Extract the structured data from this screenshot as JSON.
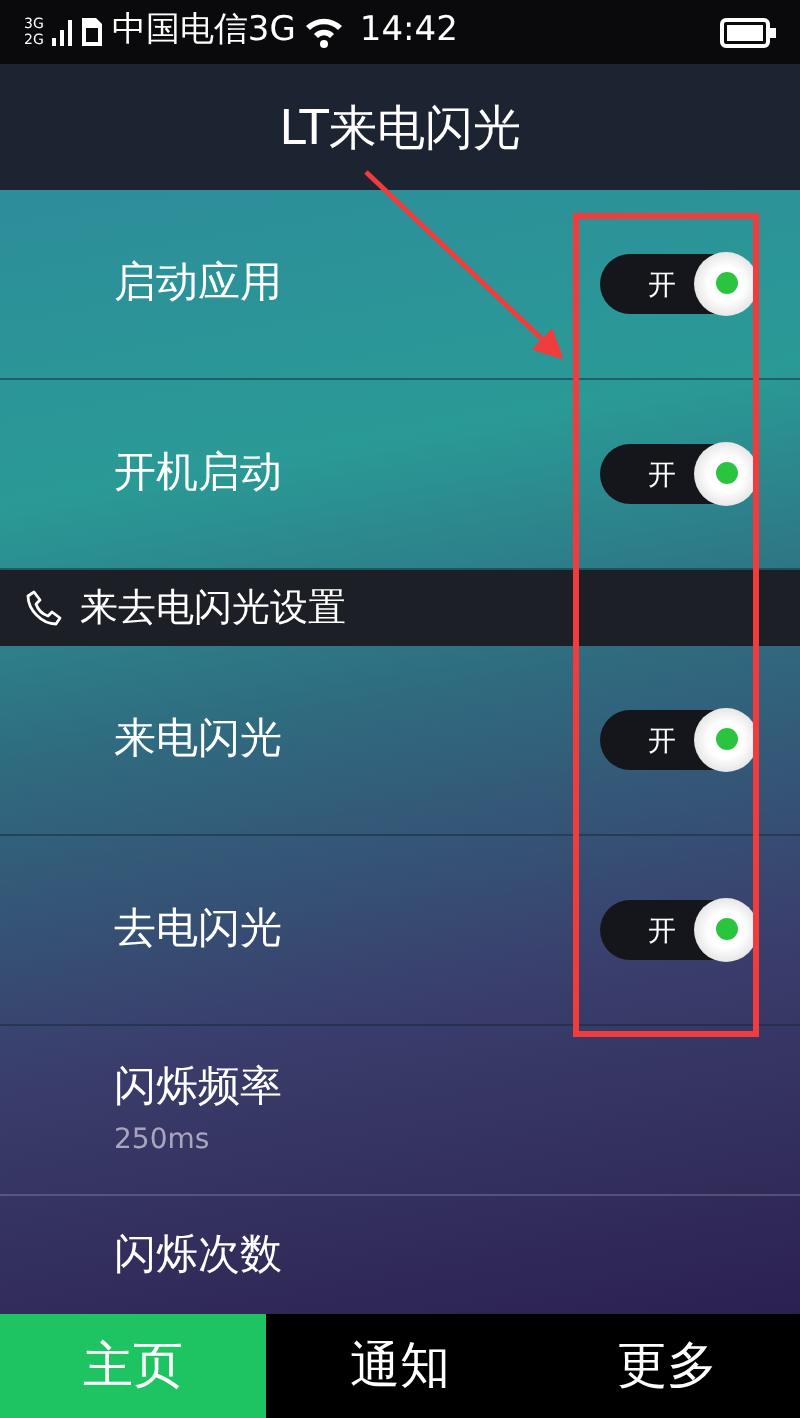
{
  "status_bar": {
    "signal_labels": [
      "3G",
      "2G"
    ],
    "carrier": "中国电信3G",
    "time": "14:42"
  },
  "title": "LT来电闪光",
  "rows": [
    {
      "kind": "toggle",
      "label": "启动应用",
      "switch_text": "开",
      "on": true
    },
    {
      "kind": "toggle",
      "label": "开机启动",
      "switch_text": "开",
      "on": true
    },
    {
      "kind": "header",
      "label": "来去电闪光设置"
    },
    {
      "kind": "toggle",
      "label": "来电闪光",
      "switch_text": "开",
      "on": true
    },
    {
      "kind": "toggle",
      "label": "去电闪光",
      "switch_text": "开",
      "on": true
    },
    {
      "kind": "value",
      "label": "闪烁频率",
      "value": "250ms"
    },
    {
      "kind": "value",
      "label": "闪烁次数"
    }
  ],
  "tabs": [
    {
      "label": "主页",
      "selected": true
    },
    {
      "label": "通知",
      "selected": false
    },
    {
      "label": "更多",
      "selected": false
    }
  ]
}
